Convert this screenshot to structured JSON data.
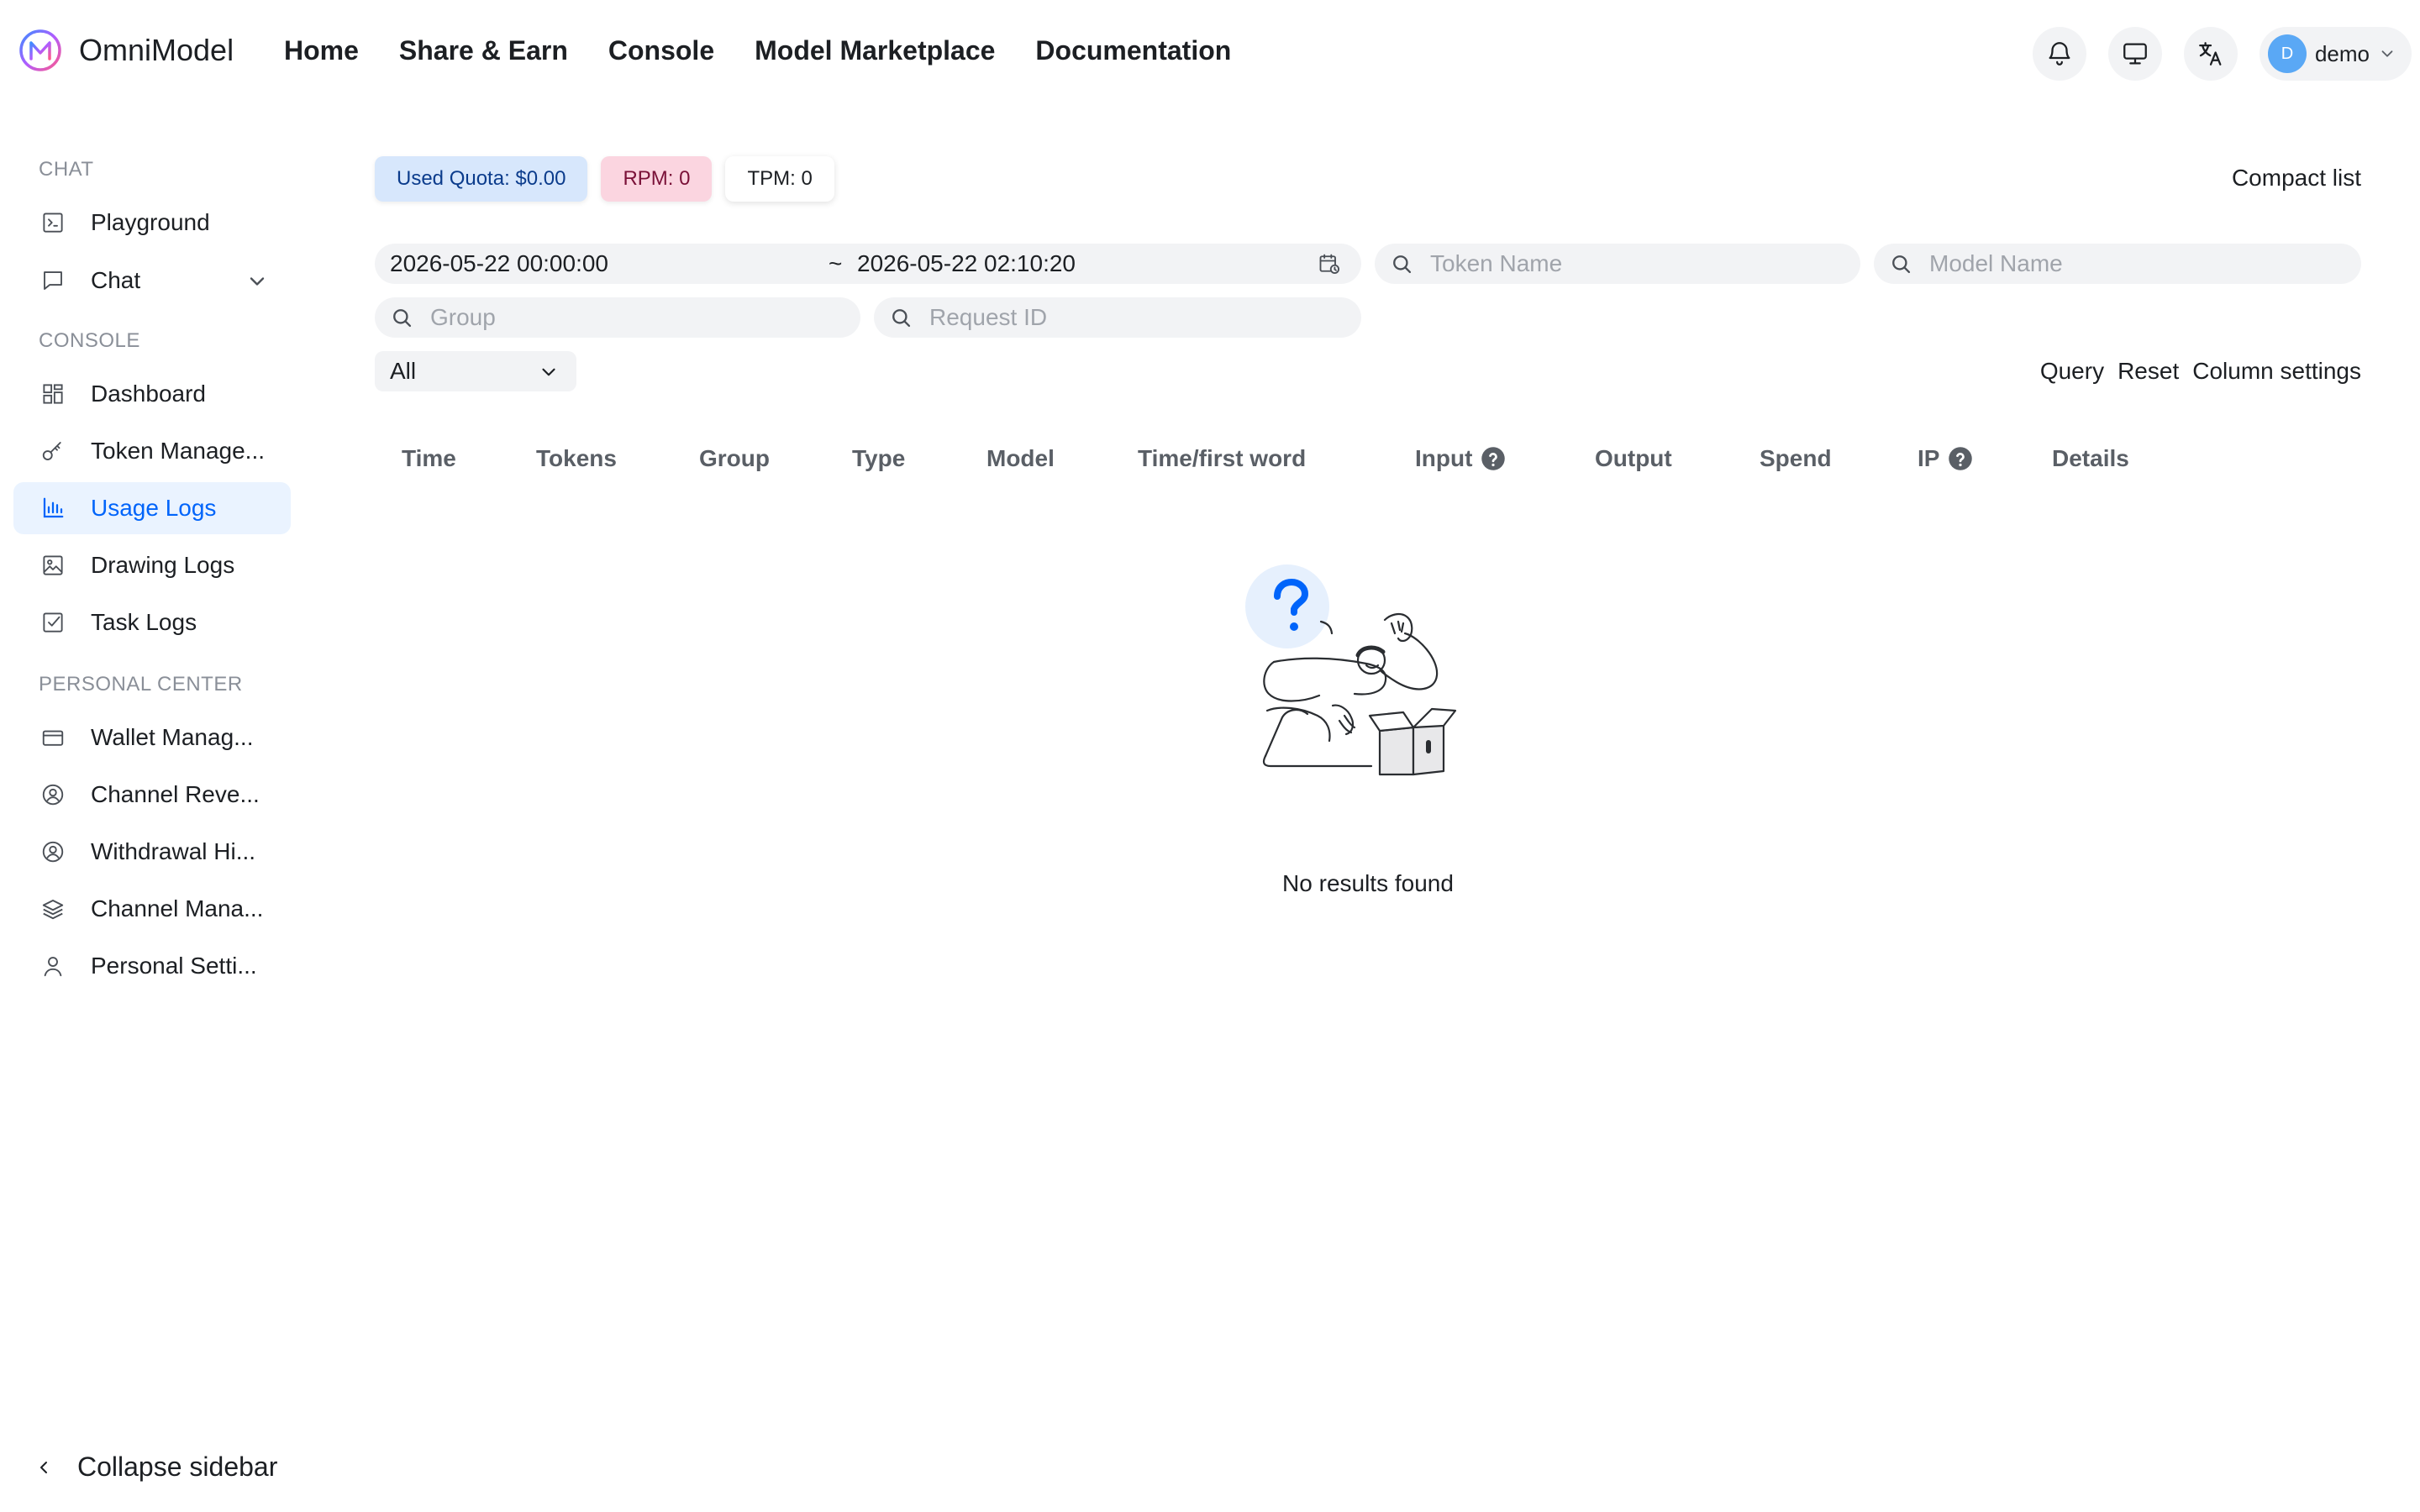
{
  "brand": {
    "name": "OmniModel"
  },
  "topnav": [
    "Home",
    "Share & Earn",
    "Console",
    "Model Marketplace",
    "Documentation"
  ],
  "header_right": {
    "icons": [
      "bell-icon",
      "monitor-icon",
      "translate-icon"
    ],
    "user": {
      "avatar_letter": "D",
      "name": "demo"
    }
  },
  "sidebar": {
    "sections": {
      "chat": "CHAT",
      "console": "CONSOLE",
      "personal": "PERSONAL CENTER"
    },
    "items": [
      {
        "label": "Playground",
        "icon": "terminal-icon"
      },
      {
        "label": "Chat",
        "icon": "chat-bubble-icon"
      },
      {
        "label": "Dashboard",
        "icon": "dashboard-grid-icon"
      },
      {
        "label": "Token Manage...",
        "icon": "key-icon"
      },
      {
        "label": "Usage Logs",
        "icon": "bar-chart-icon",
        "active": true
      },
      {
        "label": "Drawing Logs",
        "icon": "image-icon"
      },
      {
        "label": "Task Logs",
        "icon": "checkbox-icon"
      },
      {
        "label": "Wallet Manag...",
        "icon": "wallet-card-icon"
      },
      {
        "label": "Channel Reve...",
        "icon": "user-circle-icon"
      },
      {
        "label": "Withdrawal Hi...",
        "icon": "user-circle-icon"
      },
      {
        "label": "Channel Mana...",
        "icon": "layers-icon"
      },
      {
        "label": "Personal Setti...",
        "icon": "user-icon"
      }
    ],
    "collapse_label": "Collapse sidebar"
  },
  "stats": {
    "quota": "Used Quota: $0.00",
    "rpm": "RPM: 0",
    "tpm": "TPM: 0"
  },
  "compact_list": "Compact list",
  "filters": {
    "date_start": "2026-05-22 00:00:00",
    "date_sep": "~",
    "date_end": "2026-05-22 02:10:20",
    "token_name_placeholder": "Token Name",
    "model_name_placeholder": "Model Name",
    "group_placeholder": "Group",
    "request_id_placeholder": "Request ID",
    "type_select": "All"
  },
  "actions": {
    "query": "Query",
    "reset": "Reset",
    "column_settings": "Column settings"
  },
  "table": {
    "columns": [
      "Time",
      "Tokens",
      "Group",
      "Type",
      "Model",
      "Time/first word",
      "Input",
      "Output",
      "Spend",
      "IP",
      "Details"
    ]
  },
  "empty_state": {
    "text": "No results found"
  },
  "colors": {
    "accent": "#0064fa",
    "active_bg": "#eaf3ff",
    "quota_bg": "#d7e7fc",
    "rpm_bg": "#fbd5e0",
    "field_bg": "#f2f3f5"
  }
}
